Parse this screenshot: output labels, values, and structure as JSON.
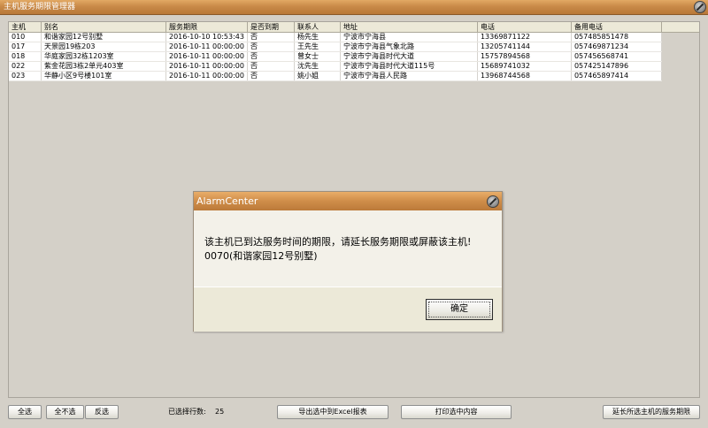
{
  "window": {
    "title": "主机服务期限管理器"
  },
  "table": {
    "columns": [
      "主机",
      "别名",
      "服务期限",
      "是否到期",
      "联系人",
      "地址",
      "电话",
      "备用电话"
    ],
    "rows": [
      [
        "010",
        "和谐家园12号别墅",
        "2016-10-10 10:53:43",
        "否",
        "杨先生",
        "宁波市宁海县",
        "13369871122",
        "057485851478"
      ],
      [
        "017",
        "天景园19栋203",
        "2016-10-11 00:00:00",
        "否",
        "王先生",
        "宁波市宁海县气象北路",
        "13205741144",
        "057469871234"
      ],
      [
        "018",
        "华庭家园32栋1203室",
        "2016-10-11 00:00:00",
        "否",
        "曾女士",
        "宁波市宁海县时代大道",
        "15757894568",
        "057456568741"
      ],
      [
        "022",
        "紫金花园3栋2单元403室",
        "2016-10-11 00:00:00",
        "否",
        "沈先生",
        "宁波市宁海县时代大道115号",
        "15689741032",
        "057425147896"
      ],
      [
        "023",
        "华静小区9号楼101室",
        "2016-10-11 00:00:00",
        "否",
        "姚小姐",
        "宁波市宁海县人民路",
        "13968744568",
        "057465897414"
      ]
    ]
  },
  "dialog": {
    "title": "AlarmCenter",
    "message_line1": "该主机已到达服务时间的期限，请延长服务期限或屏蔽该主机!",
    "message_line2": "0070(和谐家园12号别墅)",
    "ok_label": "确定"
  },
  "bottom": {
    "select_all": "全选",
    "select_none": "全不选",
    "invert": "反选",
    "selected_rows_label": "已选择行数:",
    "selected_rows_count": "25",
    "export_excel": "导出选中到Excel报表",
    "print_selected": "打印选中内容",
    "extend_service": "延长所选主机的服务期限"
  },
  "colors": {
    "title_bar": "#c98a48",
    "background": "#d4d0c8",
    "dialog_footer": "#ece9d8"
  }
}
